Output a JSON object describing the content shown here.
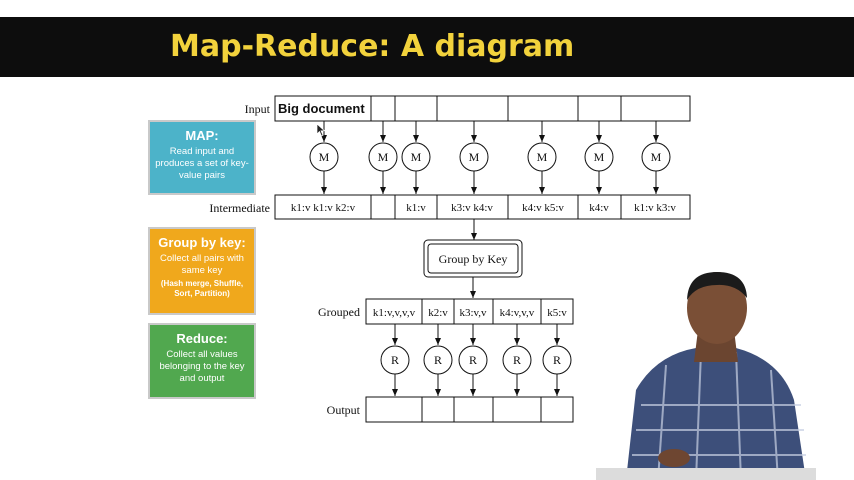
{
  "slide": {
    "title": "Map-Reduce: A diagram"
  },
  "panels": {
    "map": {
      "heading": "MAP:",
      "body": "Read input and produces a set of key-value pairs",
      "color": "#4cb3c9"
    },
    "group": {
      "heading": "Group by key:",
      "body": "Collect all pairs with same key",
      "note": "(Hash merge, Shuffle, Sort, Partition)",
      "color": "#f0a81c"
    },
    "reduce": {
      "heading": "Reduce:",
      "body": "Collect all values belonging to the key and output",
      "color": "#51a84f"
    }
  },
  "diagram": {
    "labels": {
      "input": "Input",
      "intermediate": "Intermediate",
      "grouped": "Grouped",
      "output": "Output"
    },
    "input_text": "Big document",
    "mapper_label": "M",
    "reducer_label": "R",
    "group_by_key": "Group by Key",
    "intermediate_cells": [
      "k1:v k1:v k2:v",
      "",
      "k1:v",
      "k3:v k4:v",
      "k4:v k5:v",
      "k4:v",
      "k1:v k3:v"
    ],
    "grouped_cells": [
      "k1:v,v,v,v",
      "k2:v",
      "k3:v,v",
      "k4:v,v,v",
      "k5:v"
    ]
  }
}
